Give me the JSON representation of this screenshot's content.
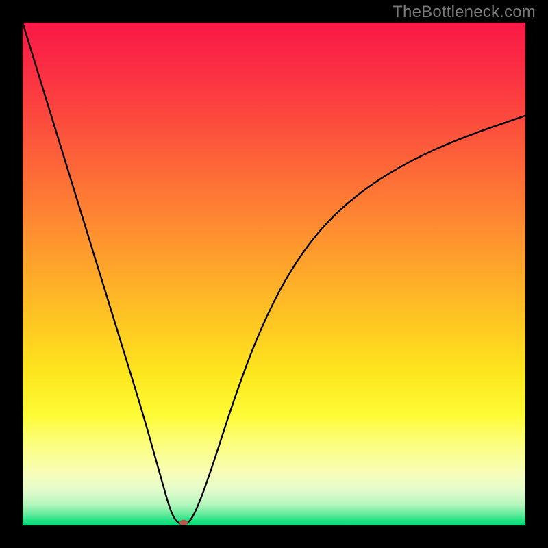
{
  "watermark": "TheBottleneck.com",
  "colors": {
    "black": "#000000",
    "curve": "#000000",
    "marker": "#b05a4a",
    "watermark": "#7a7a7a"
  },
  "gradient_stops": [
    {
      "offset": 0.0,
      "color": "#fa1846"
    },
    {
      "offset": 0.1,
      "color": "#fb3042"
    },
    {
      "offset": 0.2,
      "color": "#fc4d3d"
    },
    {
      "offset": 0.3,
      "color": "#fd6b37"
    },
    {
      "offset": 0.4,
      "color": "#fe8a31"
    },
    {
      "offset": 0.5,
      "color": "#fea92a"
    },
    {
      "offset": 0.6,
      "color": "#fec822"
    },
    {
      "offset": 0.7,
      "color": "#fde71e"
    },
    {
      "offset": 0.78,
      "color": "#fdfb35"
    },
    {
      "offset": 0.84,
      "color": "#fcfe80"
    },
    {
      "offset": 0.9,
      "color": "#f6fdbb"
    },
    {
      "offset": 0.93,
      "color": "#e3fbcb"
    },
    {
      "offset": 0.958,
      "color": "#b5f6bd"
    },
    {
      "offset": 0.978,
      "color": "#63eb9b"
    },
    {
      "offset": 0.992,
      "color": "#17e180"
    },
    {
      "offset": 1.0,
      "color": "#05dd78"
    }
  ],
  "chart_data": {
    "type": "line",
    "title": "",
    "xlabel": "",
    "ylabel": "",
    "xlim": [
      0,
      1
    ],
    "ylim": [
      0,
      1
    ],
    "note": "Bottleneck-style V curve. X is normalized component ratio, Y is bottleneck severity (0 = no bottleneck at minimum). Values estimated from pixel positions.",
    "minimum_x": 0.31,
    "marker": {
      "x": 0.32,
      "y": 0.005
    },
    "series": [
      {
        "name": "bottleneck-curve",
        "x": [
          0.0,
          0.04,
          0.08,
          0.12,
          0.16,
          0.2,
          0.24,
          0.275,
          0.295,
          0.31,
          0.33,
          0.35,
          0.38,
          0.42,
          0.47,
          0.53,
          0.6,
          0.68,
          0.77,
          0.87,
          1.0
        ],
        "y": [
          1.0,
          0.87,
          0.74,
          0.61,
          0.48,
          0.35,
          0.22,
          0.095,
          0.025,
          0.002,
          0.002,
          0.04,
          0.125,
          0.25,
          0.385,
          0.505,
          0.6,
          0.67,
          0.725,
          0.77,
          0.815
        ]
      }
    ]
  }
}
